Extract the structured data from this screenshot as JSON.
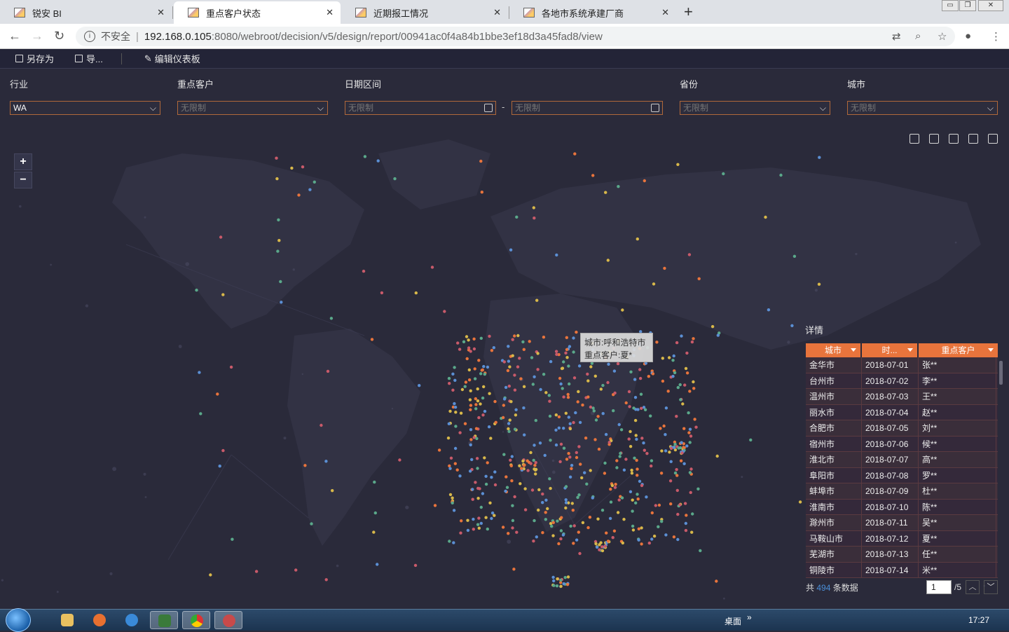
{
  "browser": {
    "tabs": [
      {
        "title": "锐安 BI"
      },
      {
        "title": "重点客户状态"
      },
      {
        "title": "近期报工情况"
      },
      {
        "title": "各地市系统承建厂商"
      }
    ],
    "insecure_label": "不安全",
    "url_host": "192.168.0.105",
    "url_path": ":8080/webroot/decision/v5/design/report/00941ac0f4a84b1bbe3ef18d3a45fad8/view"
  },
  "toolbar": {
    "save_as": "另存为",
    "export": "导...",
    "edit_dashboard": "编辑仪表板"
  },
  "filters": {
    "industry": {
      "label": "行业",
      "value": "WA"
    },
    "key_customer": {
      "label": "重点客户",
      "placeholder": "无限制"
    },
    "date_range": {
      "label": "日期区间",
      "start_placeholder": "无限制",
      "end_placeholder": "无限制",
      "separator": "-"
    },
    "province": {
      "label": "省份",
      "placeholder": "无限制"
    },
    "city": {
      "label": "城市",
      "placeholder": "无限制"
    }
  },
  "map": {
    "zoom_in": "+",
    "zoom_out": "−",
    "tooltip": {
      "line1": "城市:呼和浩特市",
      "line2": "重点客户:夏*"
    },
    "dot_colors": [
      "#e8743c",
      "#5b8fd4",
      "#d8b84a",
      "#5aa88a",
      "#c85a6a"
    ]
  },
  "detail": {
    "title": "详情",
    "columns": [
      "城市",
      "时...",
      "重点客户"
    ],
    "rows": [
      {
        "city": "金华市",
        "date": "2018-07-01",
        "customer": "张**"
      },
      {
        "city": "台州市",
        "date": "2018-07-02",
        "customer": "李**"
      },
      {
        "city": "温州市",
        "date": "2018-07-03",
        "customer": "王**"
      },
      {
        "city": "丽水市",
        "date": "2018-07-04",
        "customer": "赵**"
      },
      {
        "city": "合肥市",
        "date": "2018-07-05",
        "customer": "刘**"
      },
      {
        "city": "宿州市",
        "date": "2018-07-06",
        "customer": "候**"
      },
      {
        "city": "淮北市",
        "date": "2018-07-07",
        "customer": "高**"
      },
      {
        "city": "阜阳市",
        "date": "2018-07-08",
        "customer": "罗**"
      },
      {
        "city": "蚌埠市",
        "date": "2018-07-09",
        "customer": "杜**"
      },
      {
        "city": "淮南市",
        "date": "2018-07-10",
        "customer": "陈**"
      },
      {
        "city": "滁州市",
        "date": "2018-07-11",
        "customer": "吴**"
      },
      {
        "city": "马鞍山市",
        "date": "2018-07-12",
        "customer": "夏**"
      },
      {
        "city": "芜湖市",
        "date": "2018-07-13",
        "customer": "任**"
      },
      {
        "city": "铜陵市",
        "date": "2018-07-14",
        "customer": "米**"
      }
    ],
    "pager": {
      "prefix": "共",
      "count": "494",
      "suffix": "条数据",
      "current_page": "1",
      "total_pages": "/5"
    }
  },
  "taskbar": {
    "desktop_label": "桌面",
    "clock": "17:27"
  }
}
